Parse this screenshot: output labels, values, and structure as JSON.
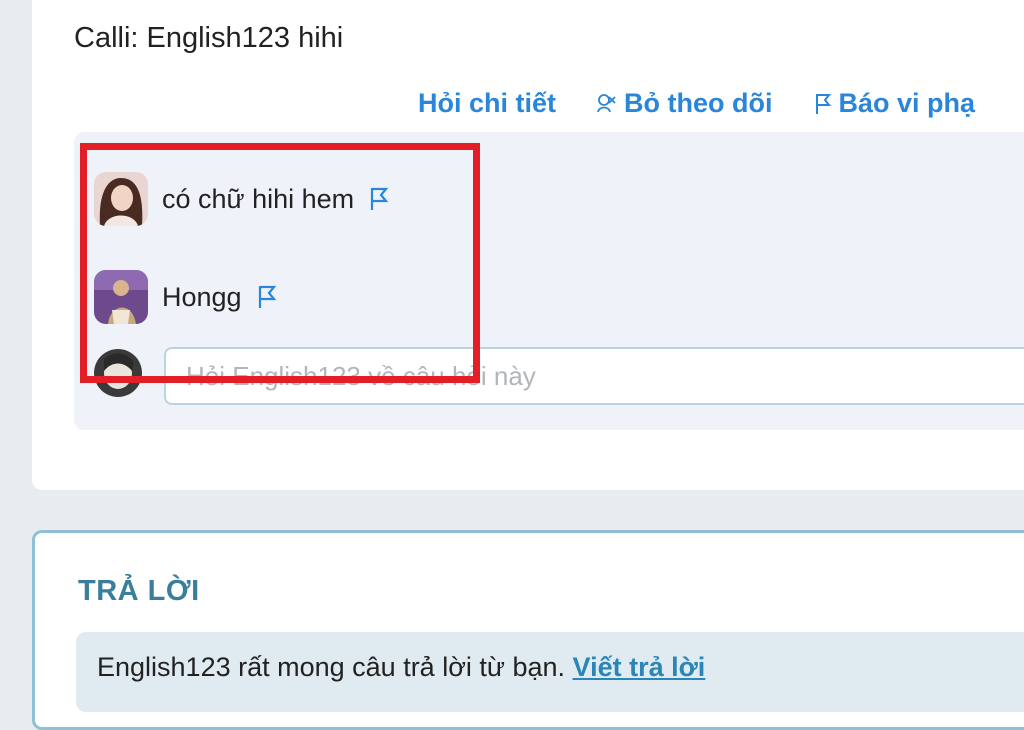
{
  "question": {
    "text": "Calli: English123 hihi"
  },
  "actions": {
    "ask_detail": "Hỏi chi tiết",
    "unfollow": "Bỏ theo dõi",
    "report": "Báo vi phạ"
  },
  "comments": [
    {
      "text": "có chữ hihi hem",
      "avatar": "avatar-photo-girl",
      "flag_icon": "flag-icon"
    },
    {
      "text": "Hongg",
      "avatar": "avatar-photo-purple",
      "flag_icon": "flag-icon"
    }
  ],
  "ask_input": {
    "placeholder": "Hỏi English123 về câu hỏi này",
    "value": ""
  },
  "answer": {
    "title": "TRẢ LỜI",
    "prompt": "English123 rất mong câu trả lời từ bạn.",
    "write_link": "Viết trả lời"
  },
  "colors": {
    "accent": "#2a86d8",
    "highlight": "#e31e26",
    "answer_title": "#3a7e9b"
  }
}
